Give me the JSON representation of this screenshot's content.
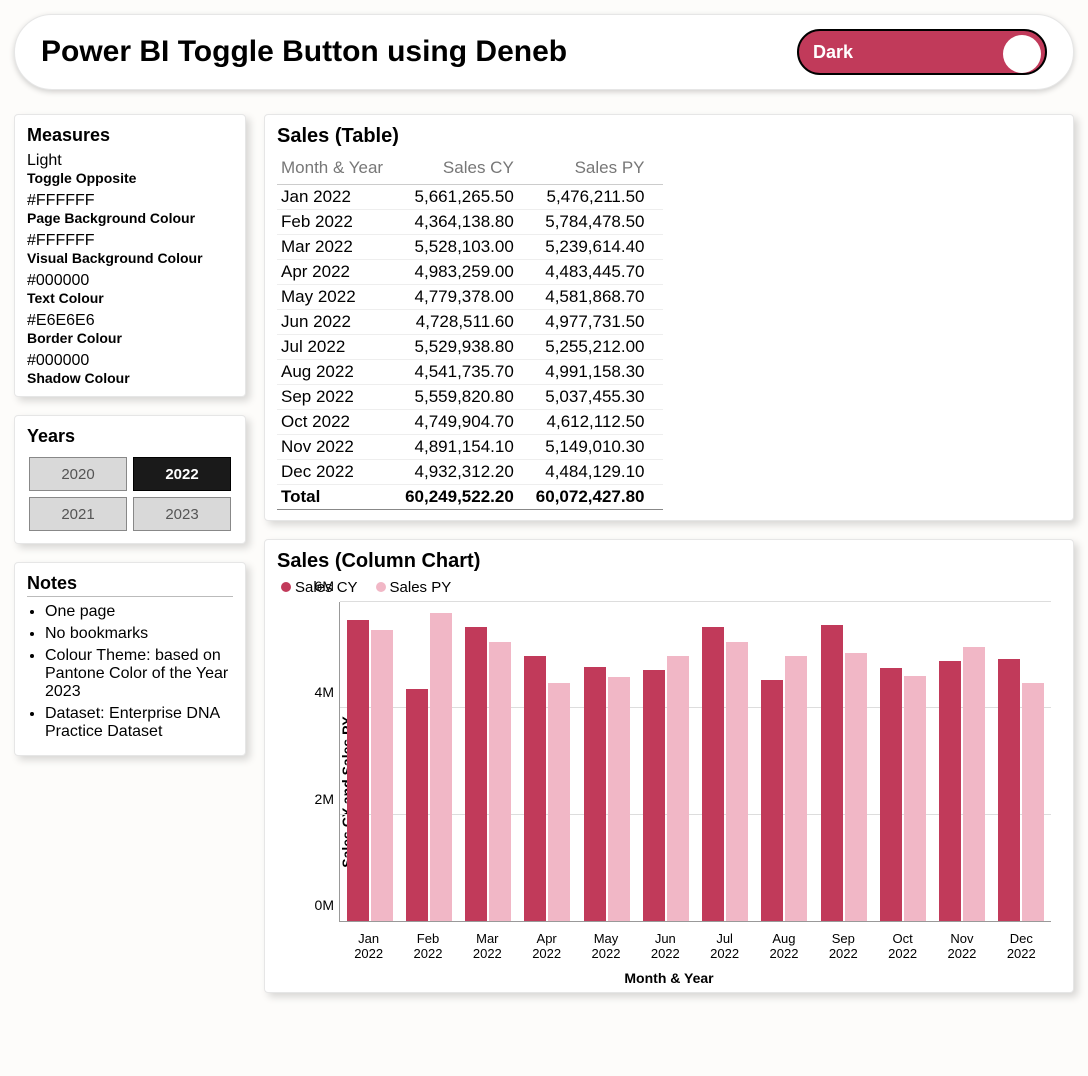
{
  "header": {
    "title": "Power BI Toggle Button using Deneb",
    "toggle_label": "Dark"
  },
  "measures": {
    "title": "Measures",
    "items": [
      {
        "value": "Light",
        "label": "Toggle Opposite"
      },
      {
        "value": "#FFFFFF",
        "label": "Page Background Colour"
      },
      {
        "value": "#FFFFFF",
        "label": "Visual Background Colour"
      },
      {
        "value": "#000000",
        "label": "Text Colour"
      },
      {
        "value": "#E6E6E6",
        "label": "Border Colour"
      },
      {
        "value": "#000000",
        "label": "Shadow Colour"
      }
    ]
  },
  "years": {
    "title": "Years",
    "options": [
      "2020",
      "2022",
      "2021",
      "2023"
    ],
    "selected": "2022"
  },
  "notes": {
    "title": "Notes",
    "items": [
      "One page",
      "No bookmarks",
      "Colour Theme: based on Pantone Color of the Year 2023",
      "Dataset: Enterprise DNA Practice Dataset"
    ]
  },
  "table": {
    "title": "Sales (Table)",
    "headers": [
      "Month & Year",
      "Sales CY",
      "Sales PY"
    ],
    "rows": [
      [
        "Jan 2022",
        "5,661,265.50",
        "5,476,211.50"
      ],
      [
        "Feb 2022",
        "4,364,138.80",
        "5,784,478.50"
      ],
      [
        "Mar 2022",
        "5,528,103.00",
        "5,239,614.40"
      ],
      [
        "Apr 2022",
        "4,983,259.00",
        "4,483,445.70"
      ],
      [
        "May 2022",
        "4,779,378.00",
        "4,581,868.70"
      ],
      [
        "Jun 2022",
        "4,728,511.60",
        "4,977,731.50"
      ],
      [
        "Jul 2022",
        "5,529,938.80",
        "5,255,212.00"
      ],
      [
        "Aug 2022",
        "4,541,735.70",
        "4,991,158.30"
      ],
      [
        "Sep 2022",
        "5,559,820.80",
        "5,037,455.30"
      ],
      [
        "Oct 2022",
        "4,749,904.70",
        "4,612,112.50"
      ],
      [
        "Nov 2022",
        "4,891,154.10",
        "5,149,010.30"
      ],
      [
        "Dec 2022",
        "4,932,312.20",
        "4,484,129.10"
      ]
    ],
    "total": [
      "Total",
      "60,249,522.20",
      "60,072,427.80"
    ]
  },
  "chart": {
    "title": "Sales (Column Chart)",
    "legend": {
      "cy": "Sales CY",
      "py": "Sales PY"
    },
    "ylabel": "Sales CY and Sales PY",
    "xlabel": "Month & Year",
    "yticks": [
      {
        "v": 0,
        "t": "0M"
      },
      {
        "v": 2000000,
        "t": "2M"
      },
      {
        "v": 4000000,
        "t": "4M"
      },
      {
        "v": 6000000,
        "t": "6M"
      }
    ],
    "ymax": 6000000
  },
  "chart_data": {
    "type": "bar",
    "title": "Sales (Column Chart)",
    "xlabel": "Month & Year",
    "ylabel": "Sales CY and Sales PY",
    "ylim": [
      0,
      6000000
    ],
    "categories": [
      "Jan 2022",
      "Feb 2022",
      "Mar 2022",
      "Apr 2022",
      "May 2022",
      "Jun 2022",
      "Jul 2022",
      "Aug 2022",
      "Sep 2022",
      "Oct 2022",
      "Nov 2022",
      "Dec 2022"
    ],
    "series": [
      {
        "name": "Sales CY",
        "color": "#c13a5a",
        "values": [
          5661265.5,
          4364138.8,
          5528103.0,
          4983259.0,
          4779378.0,
          4728511.6,
          5529938.8,
          4541735.7,
          5559820.8,
          4749904.7,
          4891154.1,
          4932312.2
        ]
      },
      {
        "name": "Sales PY",
        "color": "#f1b7c6",
        "values": [
          5476211.5,
          5784478.5,
          5239614.4,
          4483445.7,
          4581868.7,
          4977731.5,
          5255212.0,
          4991158.3,
          5037455.3,
          4612112.5,
          5149010.3,
          4484129.1
        ]
      }
    ]
  }
}
